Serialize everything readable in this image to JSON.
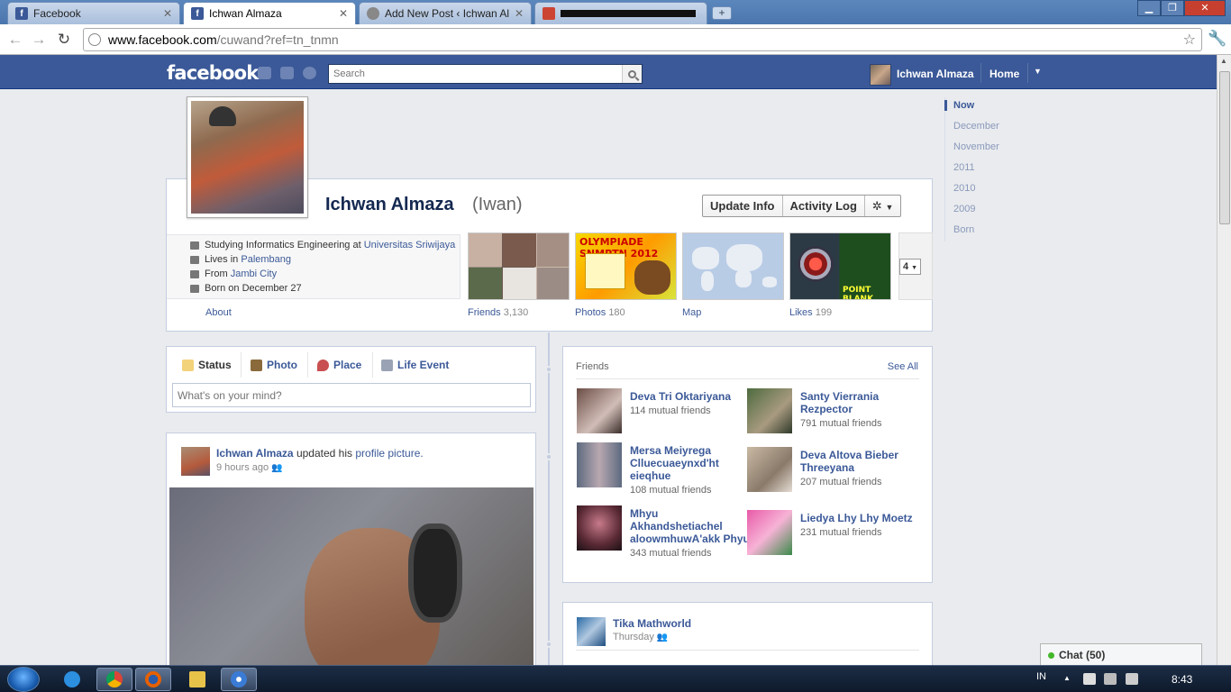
{
  "browser": {
    "tabs": [
      {
        "label": "Facebook",
        "favicon": "facebook-icon",
        "active": false
      },
      {
        "label": "Ichwan Almaza",
        "favicon": "facebook-icon",
        "active": true
      },
      {
        "label": "Add New Post ‹ Ichwan Alm",
        "favicon": "wordpress-icon",
        "active": false
      },
      {
        "label": "",
        "favicon": "home-icon",
        "active": false
      }
    ],
    "address": {
      "host": "www.facebook.com",
      "path": "/cuwand?ref=tn_tnmn"
    }
  },
  "fb_header": {
    "logo": "facebook",
    "search_placeholder": "Search",
    "user_name": "Ichwan Almaza",
    "home_label": "Home"
  },
  "profile": {
    "name": "Ichwan Almaza",
    "nickname": "(Iwan)",
    "buttons": {
      "update_info": "Update Info",
      "activity_log": "Activity Log"
    },
    "info": {
      "studying_prefix": "Studying Informatics Engineering at",
      "studying_school": "Universitas Sriwijaya",
      "lives_prefix": "Lives in",
      "lives_city": "Palembang",
      "from_prefix": "From",
      "from_city": "Jambi City",
      "born": "Born on December 27"
    },
    "about_label": "About",
    "apps": {
      "friends": {
        "label": "Friends",
        "count": "3,130"
      },
      "photos": {
        "label": "Photos",
        "count": "180",
        "poster_title": "OLYMPIADE SNMPTN 2012"
      },
      "map": {
        "label": "Map"
      },
      "likes": {
        "label": "Likes",
        "count": "199",
        "poster_title": "POINT BLANK"
      },
      "more_count": "4"
    }
  },
  "timeline_nav": [
    "Now",
    "December",
    "November",
    "2011",
    "2010",
    "2009",
    "Born"
  ],
  "composer": {
    "tabs": [
      "Status",
      "Photo",
      "Place",
      "Life Event"
    ],
    "placeholder": "What's on your mind?"
  },
  "story": {
    "author": "Ichwan Almaza",
    "action": "updated his",
    "link": "profile picture.",
    "time": "9 hours ago"
  },
  "friends_box": {
    "title": "Friends",
    "see_all": "See All",
    "items": [
      {
        "name": "Deva Tri Oktariyana",
        "mutual": "114 mutual friends"
      },
      {
        "name": "Santy Vierrania Rezpector",
        "mutual": "791 mutual friends"
      },
      {
        "name": "Mersa Meiyrega Clluecuaeynxd'ht eieqhue",
        "mutual": "108 mutual friends"
      },
      {
        "name": "Deva Altova Bieber Threeyana",
        "mutual": "207 mutual friends"
      },
      {
        "name": "Mhyu Akhandshetiachel aloowmhuwA'akk Phyu",
        "mutual": "343 mutual friends"
      },
      {
        "name": "Liedya Lhy Lhy Moetz",
        "mutual": "231 mutual friends"
      }
    ]
  },
  "story2": {
    "author": "Tika Mathworld",
    "time": "Thursday"
  },
  "chat": {
    "label": "Chat (50)"
  },
  "taskbar": {
    "lang": "IN",
    "clock": "8:43"
  }
}
